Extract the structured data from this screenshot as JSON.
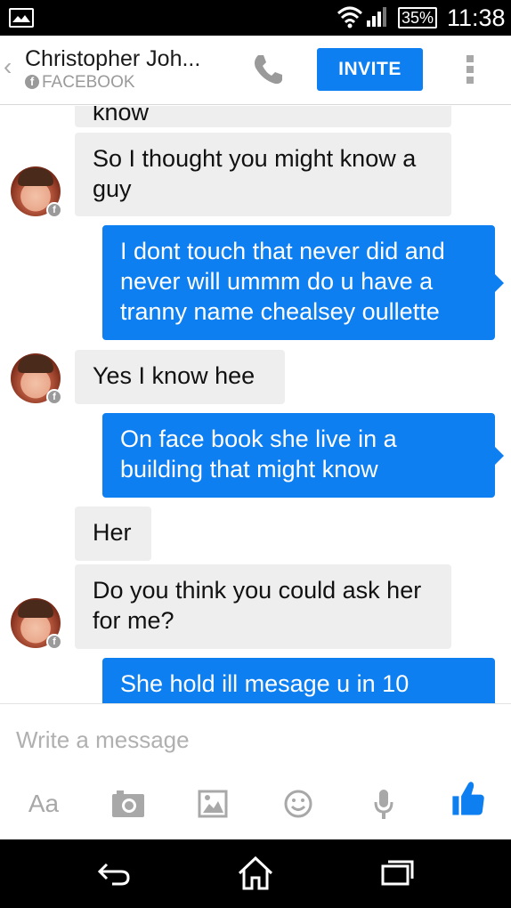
{
  "status_bar": {
    "battery_percent": "35%",
    "time": "11:38",
    "icons": [
      "image-notification-icon",
      "wifi-icon",
      "signal-icon",
      "battery-icon"
    ]
  },
  "header": {
    "back_glyph": "‹",
    "contact_name": "Christopher Joh...",
    "source_label": "FACEBOOK",
    "invite_label": "INVITE",
    "icons": [
      "back-chevron-icon",
      "facebook-icon",
      "phone-icon",
      "more-vertical-icon"
    ]
  },
  "messages": [
    {
      "direction": "in",
      "text": "know",
      "avatar": false
    },
    {
      "direction": "in",
      "text": "So I thought you might know a guy",
      "avatar": true
    },
    {
      "direction": "out",
      "text": "I dont touch that never did and never will ummm do u have a tranny name chealsey oullette"
    },
    {
      "direction": "in",
      "text": "Yes I know hee",
      "avatar": true
    },
    {
      "direction": "out",
      "text": "On face book she live in a building  that might know"
    },
    {
      "direction": "in",
      "text": "Her",
      "avatar": false
    },
    {
      "direction": "in",
      "text": "Do you think you could ask her for me?",
      "avatar": true
    },
    {
      "direction": "out",
      "text": "She hold ill mesage u in 10"
    }
  ],
  "composer": {
    "placeholder": "Write a message",
    "text_tool_label": "Aa",
    "tools": [
      "text-format-icon",
      "camera-icon",
      "gallery-icon",
      "emoji-icon",
      "microphone-icon",
      "like-thumbs-up-icon"
    ]
  },
  "nav_bar": {
    "icons": [
      "back-icon",
      "home-icon",
      "recent-apps-icon"
    ]
  },
  "colors": {
    "accent": "#0e7ff0",
    "incoming_bubble": "#eeeeee",
    "status_bar": "#000000"
  }
}
